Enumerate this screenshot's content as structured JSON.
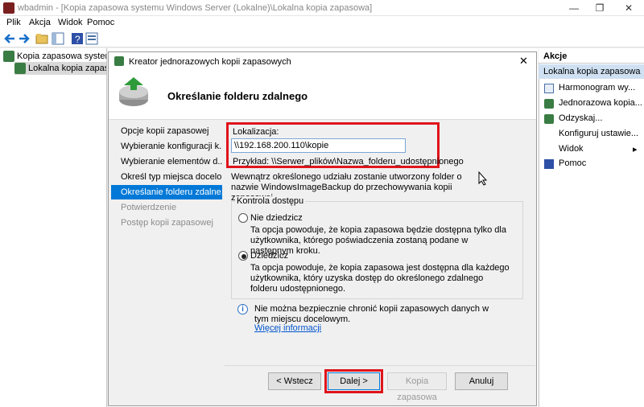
{
  "window": {
    "app_name": "wbadmin",
    "title": "wbadmin - [Kopia zapasowa systemu Windows Server (Lokalne)\\Lokalna kopia zapasowa]"
  },
  "menu": [
    "Plik",
    "Akcja",
    "Widok",
    "Pomoc"
  ],
  "tree": {
    "root": "Kopia zapasowa systemu Windows Server (Lokalne)",
    "child": "Lokalna kopia zapasowa"
  },
  "actions": {
    "header": "Akcje",
    "section": "Lokalna kopia zapasowa",
    "items": [
      {
        "label": "Harmonogram wy...",
        "icon": "calendar-icon"
      },
      {
        "label": "Jednorazowa kopia...",
        "icon": "backup-icon"
      },
      {
        "label": "Odzyskaj...",
        "icon": "recover-icon"
      },
      {
        "label": "Konfiguruj ustawie...",
        "icon": ""
      },
      {
        "label": "Widok",
        "icon": "",
        "submenu": "▸"
      },
      {
        "label": "Pomoc",
        "icon": "help-icon"
      }
    ]
  },
  "dialog": {
    "title": "Kreator jednorazowych kopii zapasowych",
    "heading": "Określanie folderu zdalnego",
    "steps": [
      {
        "label": "Opcje kopii zapasowej",
        "state": "normal"
      },
      {
        "label": "Wybieranie konfiguracji k...",
        "state": "normal"
      },
      {
        "label": "Wybieranie elementów d...",
        "state": "normal"
      },
      {
        "label": "Określ typ miejsca docelo...",
        "state": "normal"
      },
      {
        "label": "Określanie folderu zdalne...",
        "state": "active"
      },
      {
        "label": "Potwierdzenie",
        "state": "disabled"
      },
      {
        "label": "Postęp kopii zapasowej",
        "state": "disabled"
      }
    ],
    "location_label": "Lokalizacja:",
    "location_value": "\\\\192.168.200.110\\kopie",
    "example": "Przykład: \\\\Serwer_plików\\Nazwa_folderu_udostępnionego",
    "info_text": "Wewnątrz określonego udziału zostanie utworzony folder o nazwie WindowsImageBackup do przechowywania kopii zapasowej.",
    "access_group": "Kontrola dostępu",
    "option1_label": "Nie dziedzicz",
    "option1_desc": "Ta opcja powoduje, że kopia zapasowa będzie dostępna tylko dla użytkownika, którego poświadczenia zostaną podane w następnym kroku.",
    "option2_label": "Dziedzicz",
    "option2_desc": "Ta opcja powoduje, że kopia zapasowa jest dostępna dla każdego użytkownika, który uzyska dostęp do określonego zdalnego folderu udostępnionego.",
    "selected_option": "Dziedzicz",
    "warning_text": "Nie można bezpiecznie chronić kopii zapasowych danych w tym miejscu docelowym.",
    "more_info": "Więcej informacji",
    "buttons": {
      "back": "< Wstecz",
      "next": "Dalej >",
      "backup": "Kopia zapasowa",
      "cancel": "Anuluj"
    }
  },
  "colors": {
    "highlight_red": "#e0141b",
    "selection_blue": "#0078d7",
    "action_section": "#cfe0f2"
  }
}
